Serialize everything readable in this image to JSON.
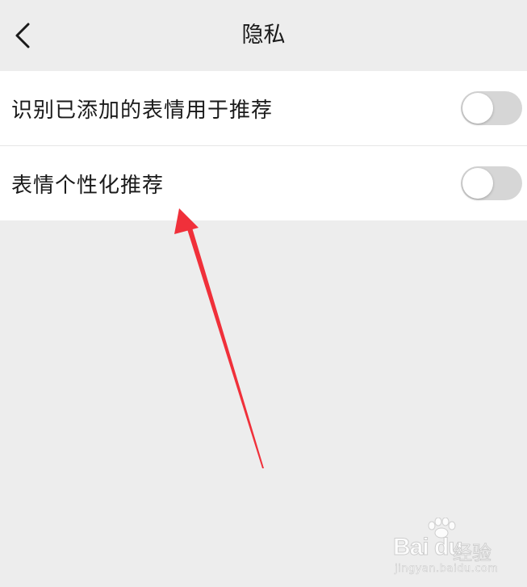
{
  "header": {
    "title": "隐私",
    "back_icon": "chevron-left-icon"
  },
  "settings": [
    {
      "label": "识别已添加的表情用于推荐",
      "enabled": false
    },
    {
      "label": "表情个性化推荐",
      "enabled": false
    }
  ],
  "colors": {
    "background": "#ededed",
    "row_background": "#ffffff",
    "toggle_off": "#d6d6d6",
    "annotation_arrow": "#f0303a"
  },
  "watermark": {
    "brand": "Bai du",
    "product": "经验",
    "url": "jingyan.baidu.com"
  }
}
